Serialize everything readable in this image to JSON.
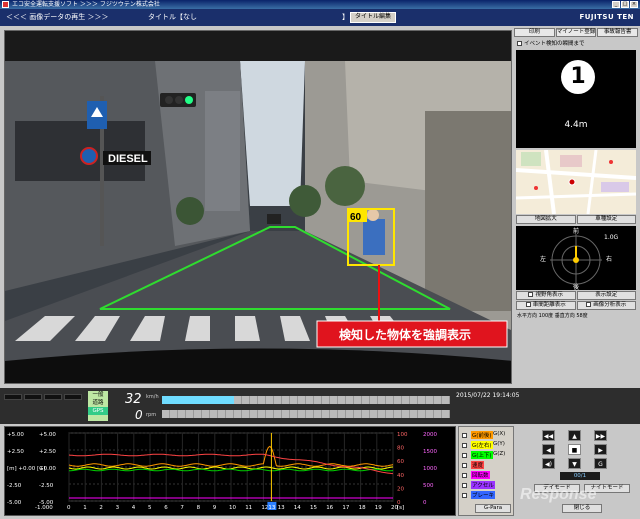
{
  "window": {
    "title": "エコ安全運転支援ソフト ＞＞＞ フジツウテン株式会社"
  },
  "header": {
    "section": "＜＜＜ 画像データの再生 ＞＞＞",
    "title_prefix": "タイトル【",
    "title_value": "なし",
    "title_suffix": "】",
    "edit_button": "タイトル編集",
    "logo": "FUJITSU TEN"
  },
  "video": {
    "sign_text": "DIESEL",
    "detection_value": "60",
    "callout": "検知した物体を強調表示"
  },
  "right_panel": {
    "tabs": [
      "印刷",
      "マイノート登録",
      "事故報告書"
    ],
    "event_option": "イベント検知の瞬間まで",
    "turn_number": "1",
    "turn_distance": "4.4m",
    "map_buttons": [
      "地図拡大",
      "車種設定"
    ],
    "compass": {
      "north": "前",
      "west": "左",
      "east": "右",
      "south": "後",
      "g_value": "1.0G"
    },
    "display_options": [
      "視野角表示",
      "表示設定",
      "車間距離表示",
      "画像分析表示"
    ],
    "view_angle": "水平方向 100度 垂直方向 58度"
  },
  "gauge_bar": {
    "mode_top": "一般",
    "mode_mid": "道路",
    "gps": "GPS",
    "speed": "32",
    "speed_unit": "km/h",
    "rpm": "0",
    "rpm_unit": "rpm",
    "speed_fraction": 0.25,
    "timestamp": "2015/07/22 19:14:05"
  },
  "graph": {
    "left_axis": [
      "+5.00",
      "+2.50",
      "[m] +0.00 [G]",
      "-2.50",
      "-5.00"
    ],
    "left_axis2": [
      "+5.00",
      "+2.50",
      "+0.00",
      "-2.50",
      "-5.00"
    ],
    "left_axis_bottom": "-1.000",
    "mid_axis": [
      "100",
      "80",
      "60",
      "40",
      "20",
      "0"
    ],
    "right_axis": [
      "2000",
      "1500",
      "1000",
      "500",
      "0"
    ],
    "x_ticks": [
      "0",
      "1",
      "2",
      "3",
      "4",
      "5",
      "6",
      "7",
      "8",
      "9",
      "10",
      "11",
      "12",
      "13",
      "14",
      "15",
      "16",
      "17",
      "18",
      "19",
      "20"
    ],
    "x_unit": "[s]",
    "cursor_label": "13"
  },
  "graph_controls": {
    "items": [
      {
        "label": "G(前後)",
        "color": "#ff9900"
      },
      {
        "label": "G(左右)",
        "color": "#ffff00"
      },
      {
        "label": "G(上下)",
        "color": "#00ff00"
      },
      {
        "label": "速度",
        "color": "#ff4444"
      },
      {
        "label": "回転数",
        "color": "#ff00ff"
      },
      {
        "label": "アクセル",
        "color": "#9933ff"
      },
      {
        "label": "ブレーキ",
        "color": "#3366ff"
      }
    ],
    "extra_items": [
      "G(X)",
      "G(Y)",
      "G(Z)"
    ],
    "param_button": "G-Para"
  },
  "playback": {
    "day_mode": "デイモード",
    "night_mode": "ナイトモード",
    "close": "閉じる",
    "g_label": "G",
    "counter": "00/1"
  },
  "watermark": "Response"
}
